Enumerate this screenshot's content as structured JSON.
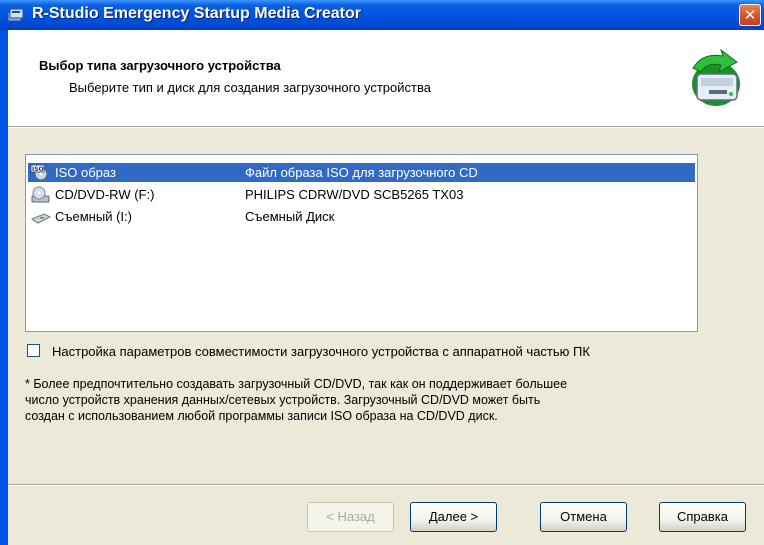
{
  "window": {
    "title": "R-Studio Emergency Startup Media Creator",
    "close_glyph": "✕"
  },
  "header": {
    "title": "Выбор типа загрузочного устройства",
    "subtitle": "Выберите тип и диск для создания загрузочного устройства"
  },
  "devices": [
    {
      "name": "ISO образ",
      "description": "Файл образа ISO для загрузочного CD",
      "icon": "iso-icon",
      "selected": true
    },
    {
      "name": "CD/DVD-RW (F:)",
      "description": "PHILIPS CDRW/DVD SCB5265 TX03",
      "icon": "cd-drive-icon",
      "selected": false
    },
    {
      "name": "Съемный (I:)",
      "description": "Съемный Диск",
      "icon": "removable-drive-icon",
      "selected": false
    }
  ],
  "compat_checkbox": {
    "label": "Настройка параметров совместимости загрузочного устройства с аппаратной частью ПК",
    "checked": false
  },
  "note": {
    "line1": "* Более предпочтительно создавать загрузочный CD/DVD, так как он поддерживает большее",
    "line2": "число устройств хранения данных/сетевых устройств. Загрузочный CD/DVD может быть",
    "line3": "создан с использованием любой программы записи ISO образа на CD/DVD диск."
  },
  "buttons": {
    "back": "< Назад",
    "next": "Далее >",
    "cancel": "Отмена",
    "help": "Справка"
  },
  "colors": {
    "selection": "#316AC5",
    "titlebar": "#0054E3",
    "dialog_bg": "#ECE9D8"
  }
}
